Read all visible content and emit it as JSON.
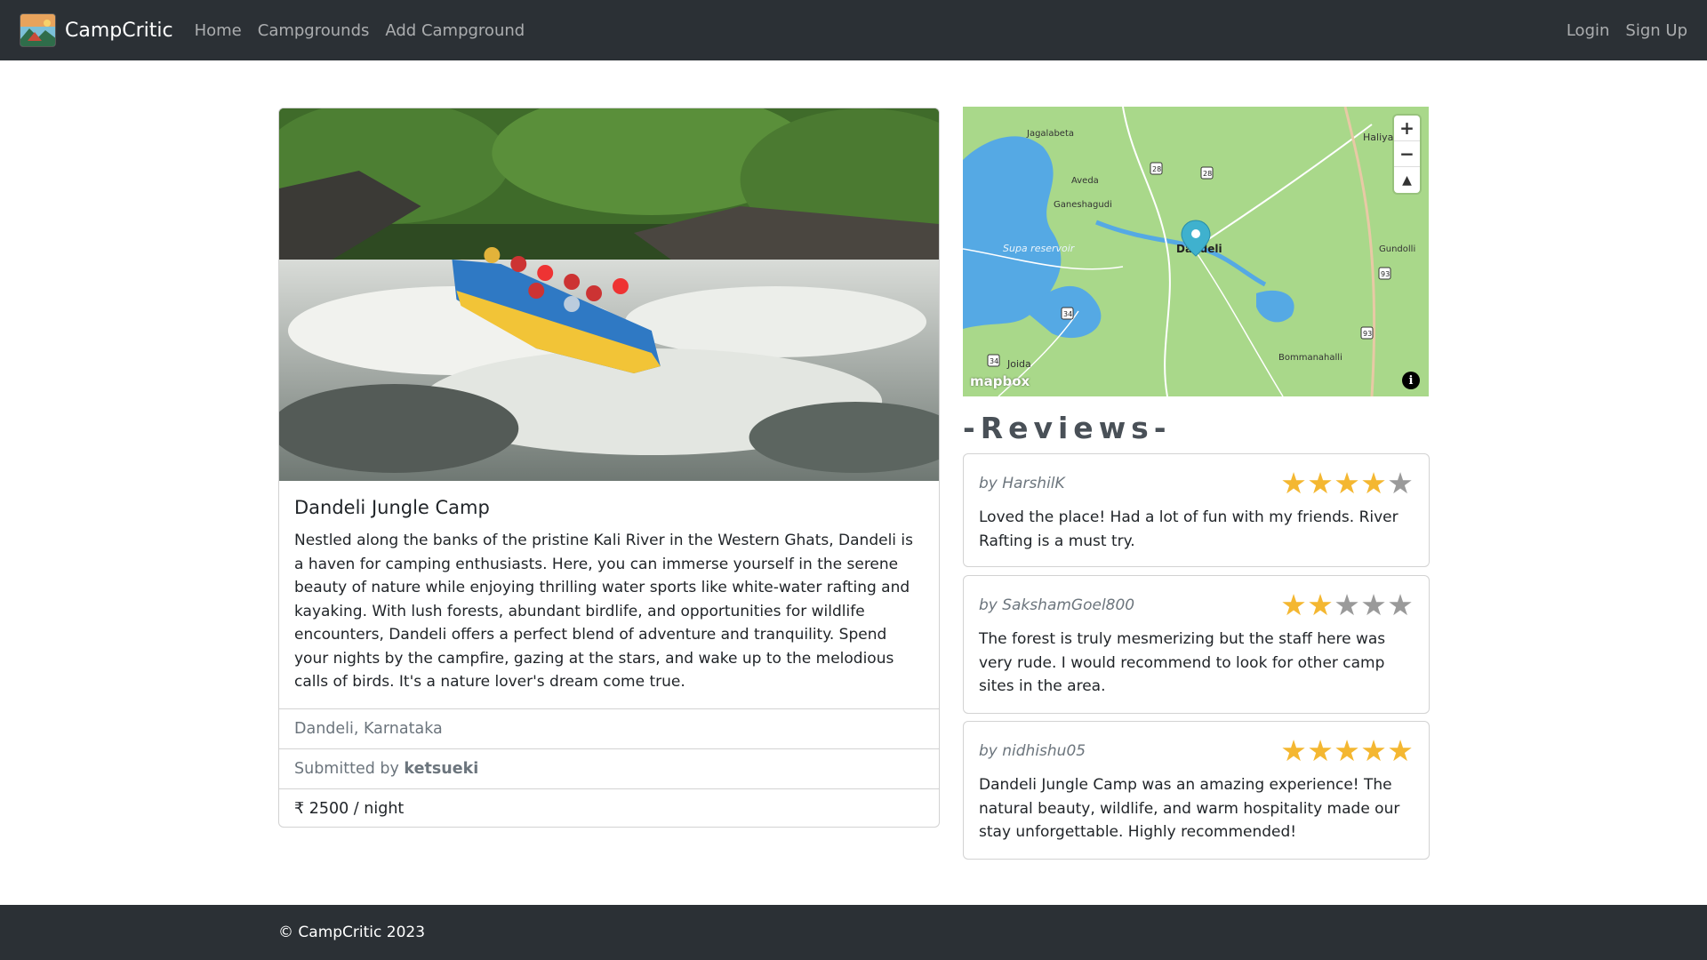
{
  "nav": {
    "brand": "CampCritic",
    "links": [
      "Home",
      "Campgrounds",
      "Add Campground"
    ],
    "login": "Login",
    "signup": "Sign Up"
  },
  "campground": {
    "title": "Dandeli Jungle Camp",
    "description": "Nestled along the banks of the pristine Kali River in the Western Ghats, Dandeli is a haven for camping enthusiasts. Here, you can immerse yourself in the serene beauty of nature while enjoying thrilling water sports like white-water rafting and kayaking. With lush forests, abundant birdlife, and opportunities for wildlife encounters, Dandeli offers a perfect blend of adventure and tranquility. Spend your nights by the campfire, gazing at the stars, and wake up to the melodious calls of birds. It's a nature lover's dream come true.",
    "location": "Dandeli, Karnataka",
    "submitted_prefix": "Submitted by ",
    "author": "ketsueki",
    "price": "₹ 2500 / night"
  },
  "map": {
    "zoom_in": "+",
    "zoom_out": "−",
    "compass": "▲",
    "attribution_logo": "mapbox",
    "info": "i",
    "labels": {
      "jagalabeta": "Jagalabeta",
      "haliyal": "Haliya",
      "aveda": "Aveda",
      "ganeshagudi": "Ganeshagudi",
      "supa": "Supa reservoir",
      "dandeli": "Dandeli",
      "gundolli": "Gundolli",
      "joida": "Joida",
      "bommanahalli": "Bommanahalli",
      "r28a": "28",
      "r28b": "28",
      "r93a": "93",
      "r93b": "93",
      "r34a": "34",
      "r34b": "34"
    }
  },
  "reviews": {
    "heading": "-Reviews-",
    "items": [
      {
        "author": "by HarshilK",
        "rating": 4,
        "text": "Loved the place! Had a lot of fun with my friends. River Rafting is a must try."
      },
      {
        "author": "by SakshamGoel800",
        "rating": 2,
        "text": "The forest is truly mesmerizing but the staff here was very rude. I would recommend to look for other camp sites in the area."
      },
      {
        "author": "by nidhishu05",
        "rating": 5,
        "text": "Dandeli Jungle Camp was an amazing experience! The natural beauty, wildlife, and warm hospitality made our stay unforgettable. Highly recommended!"
      }
    ]
  },
  "footer": {
    "text": "© CampCritic 2023"
  },
  "colors": {
    "navbar": "#2b3035",
    "star_on": "#f4b731",
    "star_off": "#9a9a9a"
  }
}
